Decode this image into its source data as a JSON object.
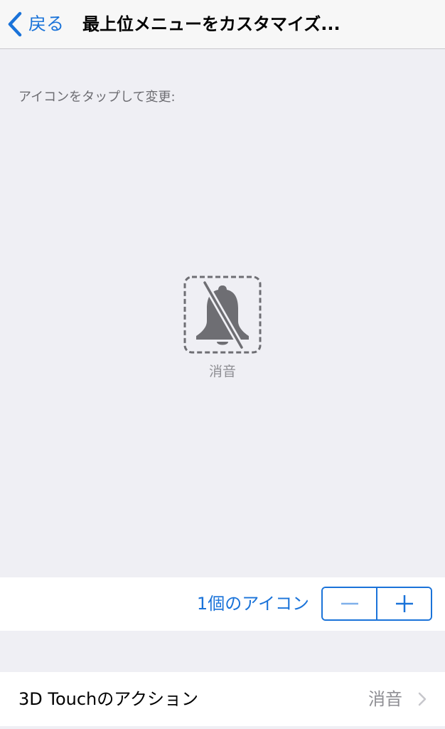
{
  "navbar": {
    "back_label": "戻る",
    "title": "最上位メニューをカスタマイズ..."
  },
  "main": {
    "instruction": "アイコンをタップして変更:",
    "icons": [
      {
        "label": "消音",
        "icon": "bell-slash-icon"
      }
    ]
  },
  "icon_count": {
    "label": "1個のアイコン",
    "decrement_symbol": "—",
    "increment_symbol": "+"
  },
  "touch_action": {
    "label": "3D Touchのアクション",
    "value": "消音"
  },
  "colors": {
    "accent": "#1a73d9",
    "background": "#efeff4",
    "icon_gray": "#6e6e73"
  }
}
